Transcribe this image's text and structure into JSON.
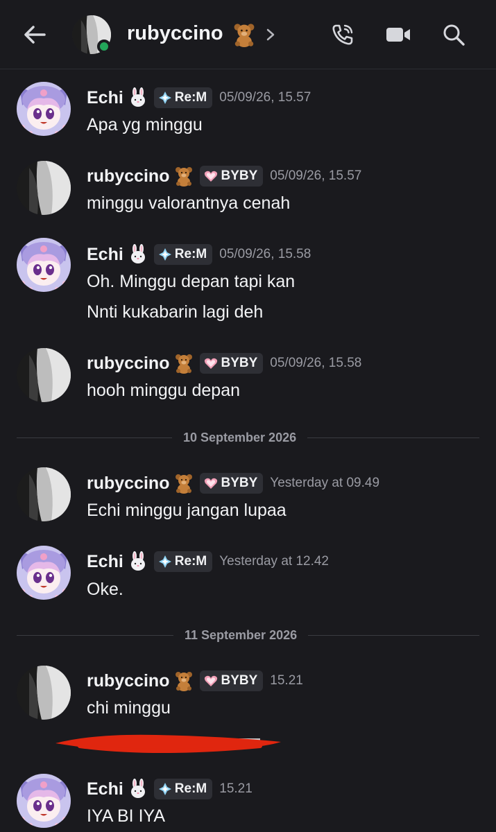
{
  "header": {
    "title": "rubyccino",
    "title_emoji": "teddy-bear",
    "status": "online"
  },
  "users": {
    "echi": {
      "name": "Echi",
      "emoji": "rabbit",
      "tag": "Re:M",
      "tag_icon": "sparkle-diamond-icon"
    },
    "ruby": {
      "name": "rubyccino",
      "emoji": "teddy-bear",
      "tag": "BYBY",
      "tag_icon": "pink-heart-icon"
    }
  },
  "messages": [
    {
      "user": "Echi",
      "tag": "Re:M",
      "time": "05/09/26, 15.57",
      "lines": [
        "Apa yg minggu"
      ]
    },
    {
      "user": "rubyccino",
      "tag": "BYBY",
      "time": "05/09/26, 15.57",
      "lines": [
        "minggu valorantnya cenah"
      ]
    },
    {
      "user": "Echi",
      "tag": "Re:M",
      "time": "05/09/26, 15.58",
      "lines": [
        "Oh. Minggu depan tapi kan",
        "Nnti kukabarin lagi deh"
      ]
    },
    {
      "user": "rubyccino",
      "tag": "BYBY",
      "time": "05/09/26, 15.58",
      "lines": [
        "hooh minggu depan"
      ]
    },
    {
      "user": "rubyccino",
      "tag": "BYBY",
      "time": "Yesterday at 09.49",
      "lines": [
        "Echi minggu jangan lupaa"
      ]
    },
    {
      "user": "Echi",
      "tag": "Re:M",
      "time": "Yesterday at 12.42",
      "lines": [
        "Oke."
      ]
    },
    {
      "user": "rubyccino",
      "tag": "BYBY",
      "time": "15.21",
      "lines": [
        "chi minggu"
      ]
    },
    {
      "user": "Echi",
      "tag": "Re:M",
      "time": "15.21",
      "lines": [
        "IYA BI IYA"
      ]
    }
  ],
  "dividers": [
    "10 September 2026",
    "11 September 2026"
  ],
  "colors": {
    "background": "#1a1a1e",
    "timestamp": "#9a9ba3",
    "online": "#23a55a",
    "redaction": "#e0260f"
  }
}
